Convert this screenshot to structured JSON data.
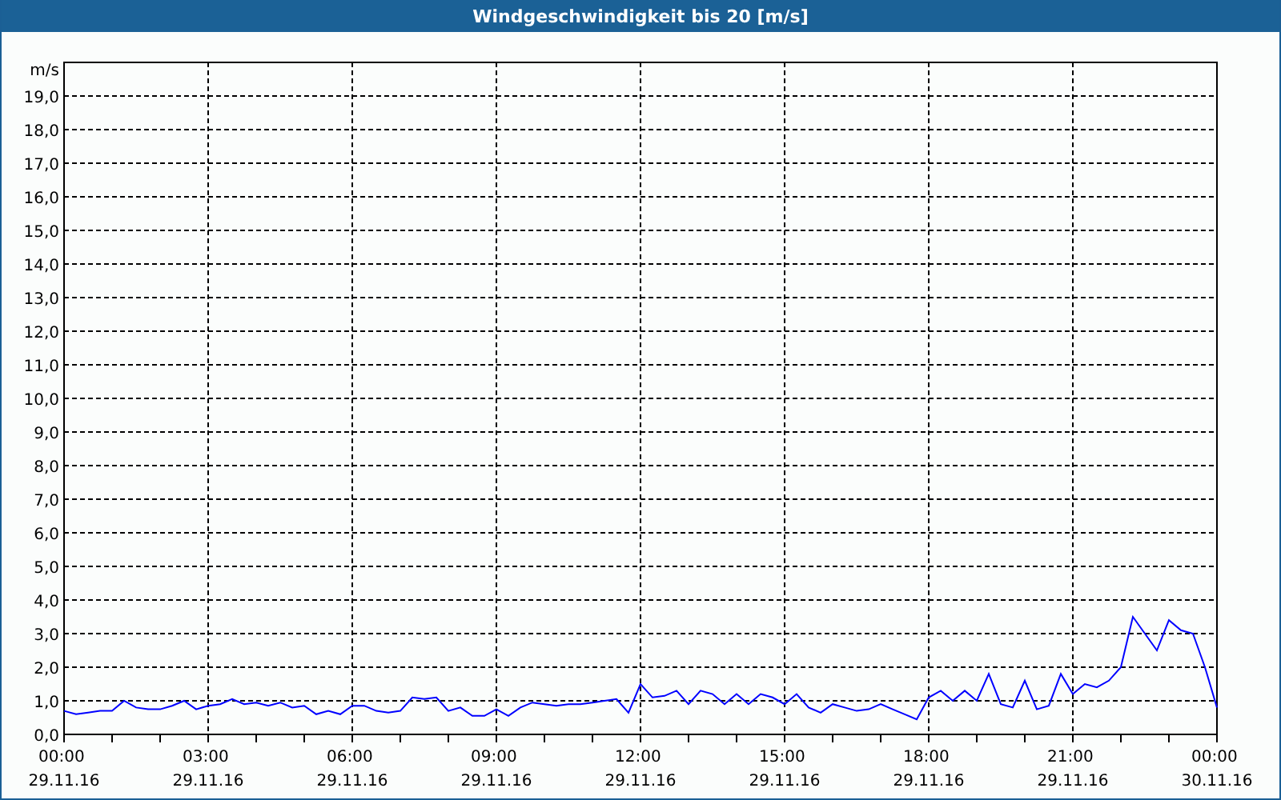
{
  "window": {
    "title": "Windgeschwindigkeit bis 20 [m/s]"
  },
  "chart": {
    "chart_data": {
      "type": "line",
      "grid": true,
      "ylabel": "m/s",
      "ylim": [
        0,
        20
      ],
      "categories": [
        "00:00 29.11.16",
        null,
        null,
        null,
        null,
        null,
        null,
        null,
        null,
        null,
        null,
        null,
        "03:00 29.11.16",
        null,
        null,
        null,
        null,
        null,
        null,
        null,
        null,
        null,
        null,
        null,
        "06:00 29.11.16",
        null,
        null,
        null,
        null,
        null,
        null,
        null,
        null,
        null,
        null,
        null,
        "09:00 29.11.16",
        null,
        null,
        null,
        null,
        null,
        null,
        null,
        null,
        null,
        null,
        null,
        "12:00 29.11.16",
        null,
        null,
        null,
        null,
        null,
        null,
        null,
        null,
        null,
        null,
        null,
        "15:00 29.11.16",
        null,
        null,
        null,
        null,
        null,
        null,
        null,
        null,
        null,
        null,
        null,
        "18:00 29.11.16",
        null,
        null,
        null,
        null,
        null,
        null,
        null,
        null,
        null,
        null,
        null,
        "21:00 29.11.16",
        null,
        null,
        null,
        null,
        null,
        null,
        null,
        null,
        null,
        null,
        null,
        "00:00 30.11.16"
      ],
      "series": [
        {
          "color": "#0000ff",
          "values": [
            0.7,
            0.6,
            0.65,
            0.7,
            0.7,
            1.0,
            0.8,
            0.75,
            0.75,
            0.85,
            1.0,
            0.75,
            0.85,
            0.9,
            1.05,
            0.9,
            0.95,
            0.85,
            0.95,
            0.8,
            0.85,
            0.6,
            0.7,
            0.6,
            0.85,
            0.85,
            0.7,
            0.65,
            0.7,
            1.1,
            1.05,
            1.1,
            0.7,
            0.8,
            0.55,
            0.55,
            0.75,
            0.55,
            0.8,
            0.95,
            0.9,
            0.85,
            0.9,
            0.9,
            0.95,
            1.0,
            1.05,
            0.65,
            1.5,
            1.1,
            1.15,
            1.3,
            0.9,
            1.3,
            1.2,
            0.9,
            1.2,
            0.9,
            1.2,
            1.1,
            0.9,
            1.2,
            0.8,
            0.65,
            0.9,
            0.8,
            0.7,
            0.75,
            0.9,
            0.75,
            0.6,
            0.45,
            1.1,
            1.3,
            1.0,
            1.3,
            1.0,
            1.8,
            0.9,
            0.8,
            1.6,
            0.75,
            0.85,
            1.8,
            1.2,
            1.5,
            1.4,
            1.6,
            2.0,
            3.5,
            3.0,
            2.5,
            3.4,
            3.1,
            3.0,
            2.0,
            0.8
          ]
        }
      ],
      "yticks": [
        {
          "value": 0,
          "label": "0,0"
        },
        {
          "value": 1,
          "label": "1,0"
        },
        {
          "value": 2,
          "label": "2,0"
        },
        {
          "value": 3,
          "label": "3,0"
        },
        {
          "value": 4,
          "label": "4,0"
        },
        {
          "value": 5,
          "label": "5,0"
        },
        {
          "value": 6,
          "label": "6,0"
        },
        {
          "value": 7,
          "label": "7,0"
        },
        {
          "value": 8,
          "label": "8,0"
        },
        {
          "value": 9,
          "label": "9,0"
        },
        {
          "value": 10,
          "label": "10,0"
        },
        {
          "value": 11,
          "label": "11,0"
        },
        {
          "value": 12,
          "label": "12,0"
        },
        {
          "value": 13,
          "label": "13,0"
        },
        {
          "value": 14,
          "label": "14,0"
        },
        {
          "value": 15,
          "label": "15,0"
        },
        {
          "value": 16,
          "label": "16,0"
        },
        {
          "value": 17,
          "label": "17,0"
        },
        {
          "value": 18,
          "label": "18,0"
        },
        {
          "value": 19,
          "label": "19,0"
        }
      ]
    }
  }
}
